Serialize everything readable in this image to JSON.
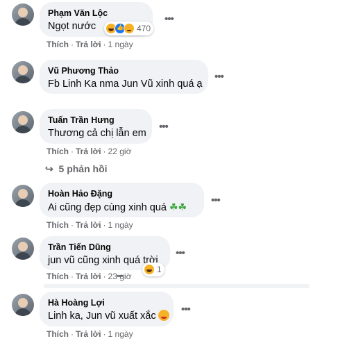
{
  "comments": [
    {
      "name": "Phạm Văn Lộc",
      "text": "Ngọt nước",
      "action_like": "Thích",
      "action_reply": "Trả lời",
      "time": "1 ngày",
      "reaction_count": "470"
    },
    {
      "name": "Vũ Phương Thảo",
      "text": "Fb Linh Ka nma Jun Vũ xinh quá ạ",
      "action_like": "",
      "action_reply": "",
      "time": ""
    },
    {
      "name": "Tuấn Trần Hưng",
      "text": "Thương cả chị lẫn em",
      "action_like": "Thích",
      "action_reply": "Trả lời",
      "time": "22 giờ"
    },
    {
      "name": "Hoàn Hảo Đặng",
      "text": "Ai cũng đẹp cùng xinh quá",
      "action_like": "Thích",
      "action_reply": "Trả lời",
      "time": "1 ngày"
    },
    {
      "name": "Trần Tiến Dũng",
      "text": "jun vũ cũng xinh quá trời",
      "action_like": "Thích",
      "action_reply": "Trả lời",
      "time": "23 giờ",
      "reaction_count": "1"
    },
    {
      "name": "Hà Hoàng Lợi",
      "text": "Linh ka, Jun vũ xuất xắc",
      "action_like": "Thích",
      "action_reply": "Trả lời",
      "time": "1 ngày"
    }
  ],
  "replies_link": "5 phản hồi",
  "more_label": "•••",
  "separator": "·",
  "colors": {
    "bubble": "#f0f2f5",
    "meta": "#65676b",
    "text": "#050505"
  }
}
